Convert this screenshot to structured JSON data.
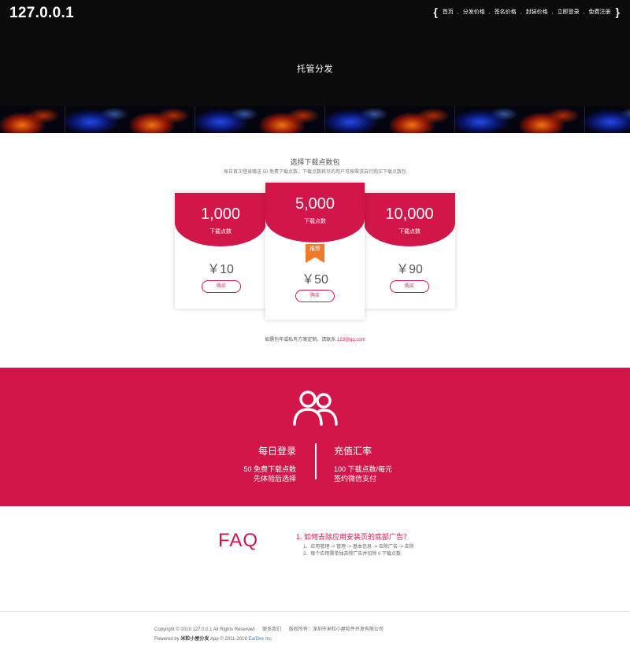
{
  "header": {
    "logo": "127.0.0.1",
    "nav": [
      "首页",
      "分发价格",
      "签名价格",
      "封装价格",
      "立即登录",
      "免费注册"
    ],
    "title": "托管分发"
  },
  "packages": {
    "title": "选择下载点数包",
    "subtitle": "每日首次登录赠送 50 免费下载点数，下载点数耗尽的用户可按需求自行购买下载点数包",
    "cards": [
      {
        "amount": "1,000",
        "unit": "下载点数",
        "price": "￥10",
        "button": "购买"
      },
      {
        "amount": "5,000",
        "unit": "下载点数",
        "price": "￥50",
        "button": "购买",
        "badge": "推荐"
      },
      {
        "amount": "10,000",
        "unit": "下载点数",
        "price": "￥90",
        "button": "购买"
      }
    ],
    "contact_text": "如需包年或私有方案定制，请联系",
    "contact_email": "123@qq.com"
  },
  "features": {
    "left": {
      "heading": "每日登录",
      "lines": [
        "50 免费下载点数",
        "先体验后选择"
      ]
    },
    "right": {
      "heading": "充值汇率",
      "lines": [
        "100 下载点数/每元",
        "签约微信支付"
      ]
    },
    "accent": "#d2164a"
  },
  "faq": {
    "title": "FAQ",
    "question": "1. 如何去除应用安装页的底部广告？",
    "answers": [
      "1、应用管理 -> 管理 -> 基本信息 -> 去除广告 -> 去除",
      "2、每个应用需单独去除广告并扣除 0 下载点数"
    ]
  },
  "footer": {
    "copyright": "Copyright © 2019 127.0.0.1 All Rights Reserved",
    "contact": "联系我们",
    "owner": "版权所有：深圳市米粒小屋软件开发有限公司",
    "powered_prefix": "Powered by",
    "powered_brand": "米粒小屋分发",
    "powered_app": "App © 2011-2019",
    "powered_dev": "EarDev Inc"
  }
}
